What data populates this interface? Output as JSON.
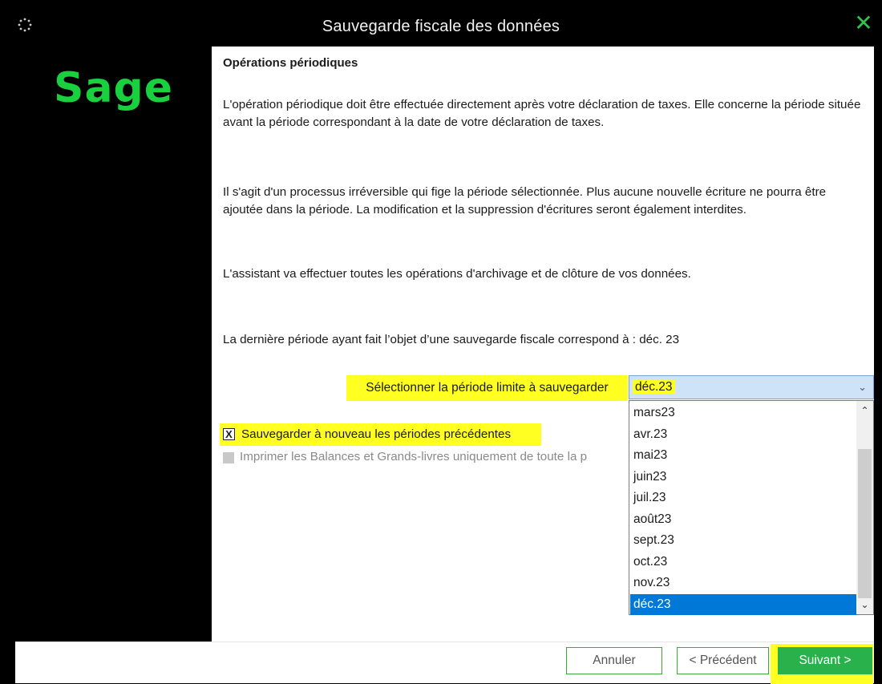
{
  "window": {
    "title": "Sauvegarde fiscale des données",
    "close_glyph": "✕",
    "accent_color": "#19d13e"
  },
  "sidebar": {
    "logo_text": "Sage"
  },
  "content": {
    "heading": "Opérations périodiques",
    "paragraph_1": "L'opération périodique doit être effectuée directement après votre déclaration de taxes. Elle concerne la période située avant la période correspondant à la date de votre déclaration de taxes.",
    "paragraph_2": "Il s'agit d'un processus irréversible qui fige la période sélectionnée. Plus aucune nouvelle écriture ne pourra être ajoutée dans la période. La modification et la suppression d'écritures seront également interdites.",
    "paragraph_3": "L'assistant va effectuer toutes les opérations d'archivage et de clôture de vos données.",
    "paragraph_4": "La dernière période ayant fait l’objet d’une sauvegarde fiscale correspond à : déc. 23"
  },
  "period_select": {
    "label": "Sélectionner la période limite à sauvegarder",
    "value": "déc.23",
    "options": [
      "mars23",
      "avr.23",
      "mai23",
      "juin23",
      "juil.23",
      "août23",
      "sept.23",
      "oct.23",
      "nov.23",
      "déc.23"
    ],
    "selected_index": 9
  },
  "checkboxes": {
    "resave": {
      "label": "Sauvegarder à nouveau les périodes précédentes",
      "checked": true,
      "mark": "X"
    },
    "print": {
      "label": "Imprimer les Balances et Grands-livres uniquement de toute la p",
      "checked": false,
      "disabled": true
    }
  },
  "buttons": {
    "cancel": "Annuler",
    "previous": "< Précédent",
    "next": "Suivant >"
  },
  "icons": {
    "app": "spinner-icon",
    "close": "close-icon",
    "chevron": "chevron-down-icon",
    "scroll_up": "scroll-up-icon",
    "scroll_down": "scroll-down-icon"
  }
}
